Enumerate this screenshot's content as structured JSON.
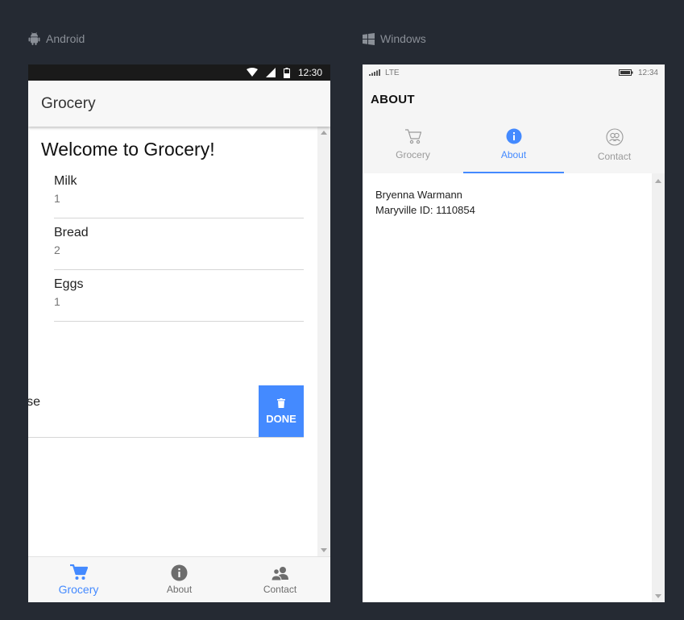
{
  "labels": {
    "android": "Android",
    "windows": "Windows"
  },
  "colors": {
    "background": "#252a33",
    "accent": "#448aff"
  },
  "android": {
    "status_time": "12:30",
    "toolbar_title": "Grocery",
    "heading": "Welcome to Grocery!",
    "items": [
      {
        "name": "Milk",
        "qty": "1"
      },
      {
        "name": "Bread",
        "qty": "2"
      },
      {
        "name": "Eggs",
        "qty": "1"
      }
    ],
    "swiped_item_text": "se",
    "done_label": "DONE",
    "tabs": [
      {
        "label": "Grocery",
        "icon": "cart-icon",
        "active": true
      },
      {
        "label": "About",
        "icon": "info-icon",
        "active": false
      },
      {
        "label": "Contact",
        "icon": "contacts-icon",
        "active": false
      }
    ]
  },
  "windows": {
    "status_network": "LTE",
    "status_time": "12:34",
    "title": "ABOUT",
    "tabs": [
      {
        "label": "Grocery",
        "icon": "cart-icon",
        "active": false
      },
      {
        "label": "About",
        "icon": "info-icon",
        "active": true
      },
      {
        "label": "Contact",
        "icon": "contacts-icon",
        "active": false
      }
    ],
    "about_lines": [
      "Bryenna Warmann",
      "Maryville ID: 1110854"
    ]
  }
}
